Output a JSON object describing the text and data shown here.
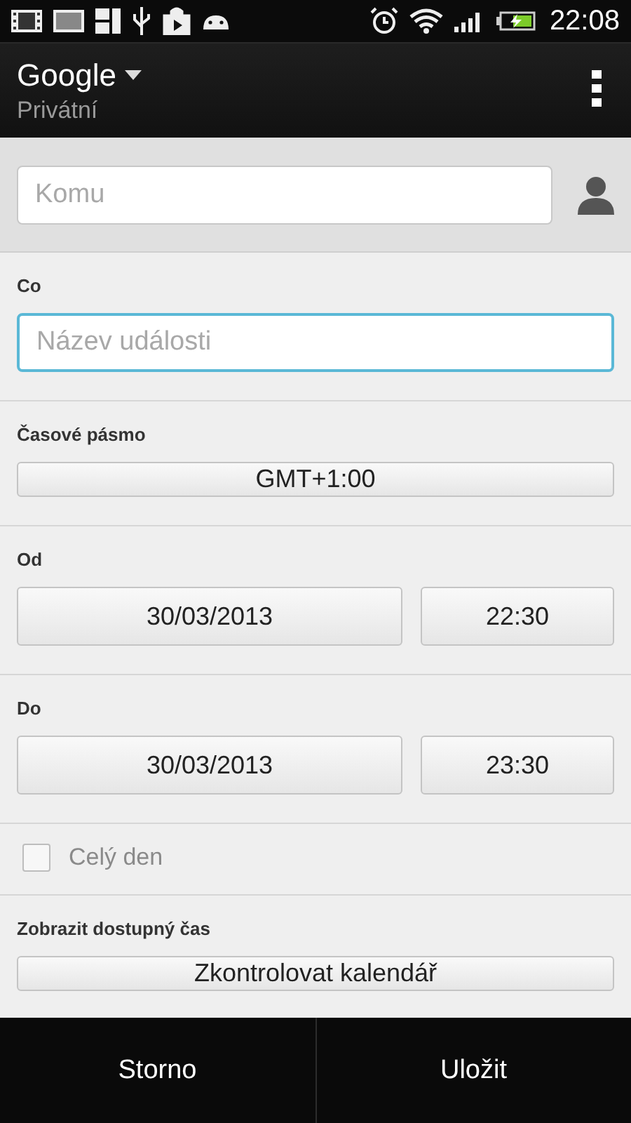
{
  "status_bar": {
    "time": "22:08"
  },
  "header": {
    "account": "Google",
    "calendar": "Privátní"
  },
  "recipient": {
    "placeholder": "Komu"
  },
  "sections": [
    {
      "kind": "text_field",
      "label": "Co",
      "placeholder": "Název události",
      "focused": true
    },
    {
      "kind": "button",
      "label": "Časové pásmo",
      "value": "GMT+1:00"
    },
    {
      "kind": "date_time",
      "label": "Od",
      "date": "30/03/2013",
      "time": "22:30"
    },
    {
      "kind": "date_time",
      "label": "Do",
      "date": "30/03/2013",
      "time": "23:30"
    },
    {
      "kind": "checkbox",
      "label": "Celý den",
      "checked": false
    },
    {
      "kind": "button",
      "label": "Zobrazit dostupný čas",
      "value": "Zkontrolovat kalendář"
    }
  ],
  "bottom_buttons": [
    "Storno",
    "Uložit"
  ]
}
